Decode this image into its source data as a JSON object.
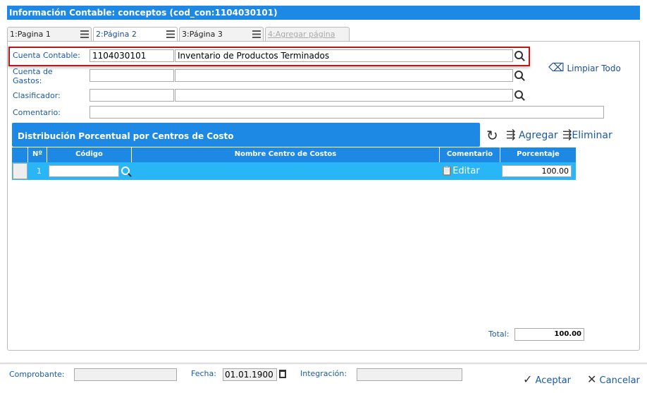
{
  "title": "Información Contable: conceptos (cod_con:1104030101)",
  "tabs": [
    {
      "label": "1:Pagina 1"
    },
    {
      "label": "2:Página 2"
    },
    {
      "label": "3:Página 3"
    },
    {
      "label": "4:Agregar página"
    }
  ],
  "form": {
    "cuenta_contable_label": "Cuenta Contable:",
    "cuenta_contable_code": "1104030101",
    "cuenta_contable_name": "Inventario de Productos Terminados",
    "cuenta_gastos_label": "Cuenta de Gastos:",
    "clasificador_label": "Clasificador:",
    "comentario_label": "Comentario:",
    "limpiar_label": "Limpiar Todo"
  },
  "distribution": {
    "title": "Distribución Porcentual por Centros de Costo",
    "add_label": "Agregar",
    "delete_label": "Eliminar",
    "columns": [
      "Nº",
      "Código",
      "Nombre Centro de Costos",
      "Comentario",
      "Porcentaje"
    ],
    "rows": [
      {
        "n": "1",
        "codigo": "",
        "nombre": "",
        "comentario": "Editar",
        "porcentaje": "100.00"
      }
    ],
    "total_label": "Total:",
    "total": "100.00"
  },
  "footer": {
    "comprobante_label": "Comprobante:",
    "fecha_label": "Fecha:",
    "fecha": "01.01.1900",
    "integracion_label": "Integración:",
    "accept_label": "Aceptar",
    "cancel_label": "Cancelar"
  }
}
